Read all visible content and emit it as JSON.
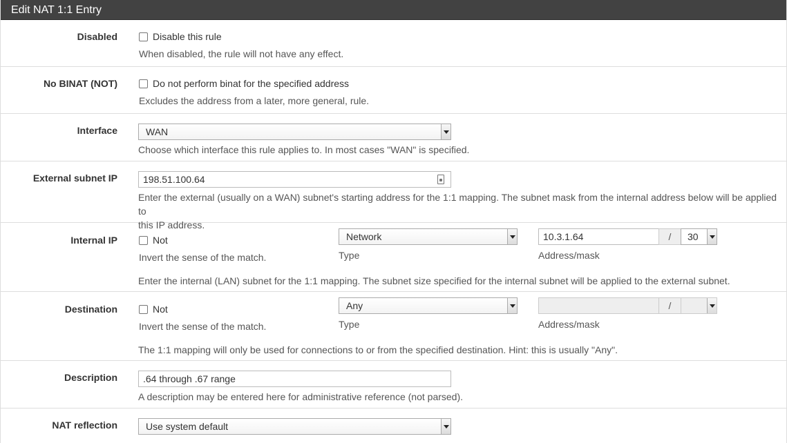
{
  "panel": {
    "title": "Edit NAT 1:1 Entry"
  },
  "disabled": {
    "label": "Disabled",
    "checkbox_label": "Disable this rule",
    "checked": false,
    "help": "When disabled, the rule will not have any effect."
  },
  "nobinat": {
    "label": "No BINAT (NOT)",
    "checkbox_label": "Do not perform binat for the specified address",
    "checked": false,
    "help": "Excludes the address from a later, more general, rule."
  },
  "interface": {
    "label": "Interface",
    "value": "WAN",
    "help": "Choose which interface this rule applies to. In most cases \"WAN\" is specified."
  },
  "external": {
    "label": "External subnet IP",
    "value": "198.51.100.64",
    "help_line1": "Enter the external (usually on a WAN) subnet's starting address for the 1:1 mapping. The subnet mask from the internal address below will be applied to",
    "help_line2": "this IP address."
  },
  "internal": {
    "label": "Internal IP",
    "not_label": "Not",
    "not_checked": false,
    "not_help": "Invert the sense of the match.",
    "type_value": "Network",
    "type_label": "Type",
    "address": "10.3.1.64",
    "slash": "/",
    "mask": "30",
    "address_label": "Address/mask",
    "help": "Enter the internal (LAN) subnet for the 1:1 mapping. The subnet size specified for the internal subnet will be applied to the external subnet."
  },
  "destination": {
    "label": "Destination",
    "not_label": "Not",
    "not_checked": false,
    "not_help": "Invert the sense of the match.",
    "type_value": "Any",
    "type_label": "Type",
    "address": "",
    "slash": "/",
    "mask": "",
    "address_label": "Address/mask",
    "help": "The 1:1 mapping will only be used for connections to or from the specified destination. Hint: this is usually \"Any\"."
  },
  "description": {
    "label": "Description",
    "value": ".64 through .67 range",
    "help": "A description may be entered here for administrative reference (not parsed)."
  },
  "reflection": {
    "label": "NAT reflection",
    "value": "Use system default"
  }
}
